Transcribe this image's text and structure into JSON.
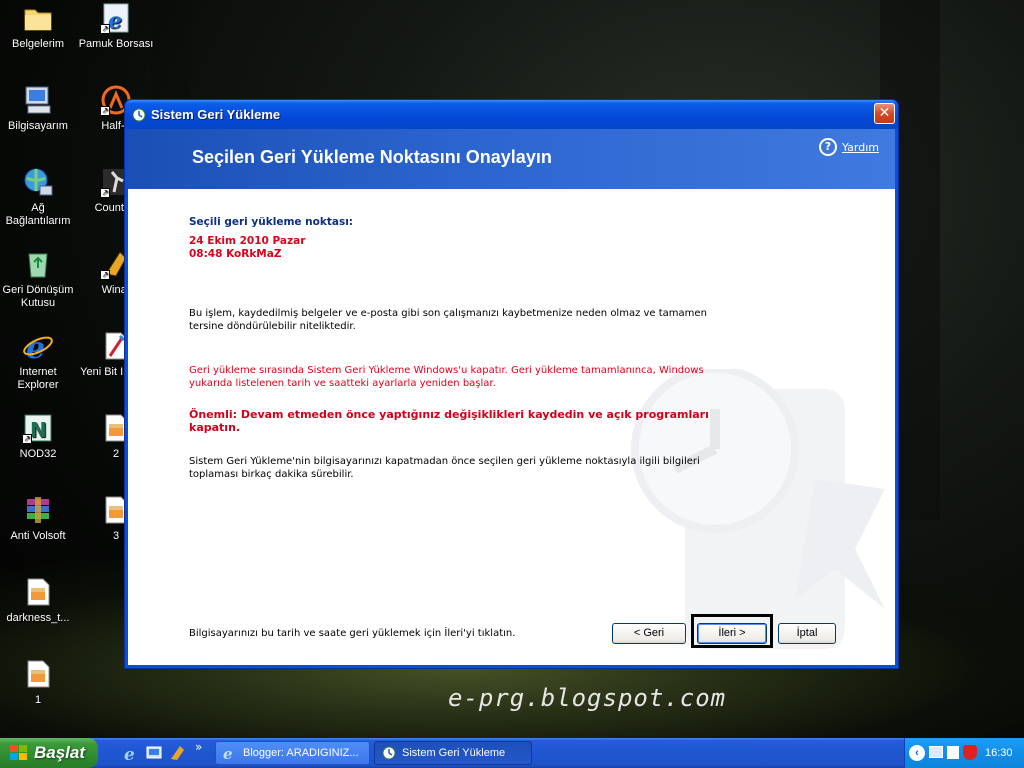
{
  "desktop": {
    "icons_col1": [
      "Belgelerim",
      "Bilgisayarım",
      "Ağ Bağlantılarım",
      "Geri Dönüşüm Kutusu",
      "Internet Explorer",
      "NOD32",
      "Anti Volsoft",
      "darkness_t...",
      "1"
    ],
    "icons_col2": [
      "Pamuk Borsası",
      "Half-L",
      "Counter-",
      "Winar",
      "Yeni Bit I Resn",
      "2",
      "3"
    ]
  },
  "dialog": {
    "title": "Sistem Geri Yükleme",
    "close_glyph": "✕",
    "header": "Seçilen Geri Yükleme Noktasını Onaylayın",
    "help_glyph": "?",
    "help_label": "Yardım",
    "selected_label": "Seçili geri yükleme noktası:",
    "selected_date": "24 Ekim 2010 Pazar",
    "selected_time": "08:48 KoRkMaZ",
    "para1": "Bu işlem, kaydedilmiş belgeler ve e-posta gibi son çalışmanızı kaybetmenize neden olmaz ve tamamen tersine döndürülebilir niteliktedir.",
    "para2": "Geri yükleme sırasında Sistem Geri Yükleme Windows'u kapatır. Geri yükleme tamamlanınca, Windows yukarıda listelenen tarih ve saatteki ayarlarla yeniden başlar.",
    "warning": "Önemli: Devam etmeden önce yaptığınız değişiklikleri kaydedin ve açık programları kapatın.",
    "para3": "Sistem Geri Yükleme'nin bilgisayarınızı kapatmadan önce seçilen geri yükleme noktasıyla ilgili bilgileri toplaması birkaç dakika sürebilir.",
    "footer_text": "Bilgisayarınızı bu tarih ve saate geri yüklemek için İleri'yi tıklatın.",
    "btn_back": "< Geri",
    "btn_next": "İleri >",
    "btn_cancel": "İptal"
  },
  "watermark_text": "e-prg.blogspot.com",
  "taskbar": {
    "start_label": "Başlat",
    "chevron": "»",
    "tasks": [
      "Blogger: ARADIGINIZ...",
      "Sistem Geri Yükleme"
    ],
    "clock": "16:30"
  }
}
